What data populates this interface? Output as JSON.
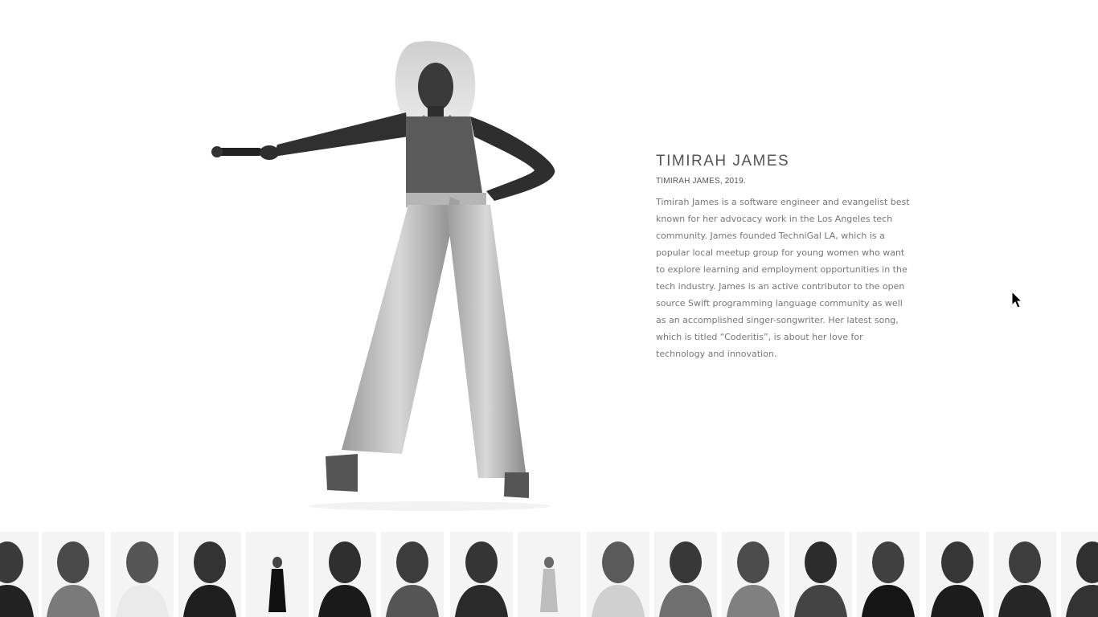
{
  "profile": {
    "name": "TIMIRAH JAMES",
    "caption": "TIMIRAH JAMES, 2019.",
    "bio": "Timirah James is a software engineer and evangelist best known for her advocacy work in the Los Angeles tech community. James founded TechniGal LA, which is a popular local meetup group for young women who want to explore learning and employment opportunities in the tech industry. James is an active contributor to the open source Swift programming language community as well as an accomplished singer-songwriter. Her latest song, which is titled “Coderitis”, is about her love for technology and innovation."
  },
  "gallery": {
    "thumbnails": [
      {
        "id": "portrait-01"
      },
      {
        "id": "portrait-02"
      },
      {
        "id": "portrait-03"
      },
      {
        "id": "portrait-04"
      },
      {
        "id": "portrait-05"
      },
      {
        "id": "portrait-06"
      },
      {
        "id": "portrait-07"
      },
      {
        "id": "portrait-08"
      },
      {
        "id": "portrait-09"
      },
      {
        "id": "portrait-10"
      },
      {
        "id": "portrait-11"
      },
      {
        "id": "portrait-12"
      },
      {
        "id": "portrait-13"
      },
      {
        "id": "portrait-14"
      },
      {
        "id": "portrait-15"
      },
      {
        "id": "portrait-16"
      },
      {
        "id": "portrait-17"
      }
    ]
  },
  "colors": {
    "background": "#ffffff",
    "heading": "#555555",
    "body_text": "#777777"
  }
}
